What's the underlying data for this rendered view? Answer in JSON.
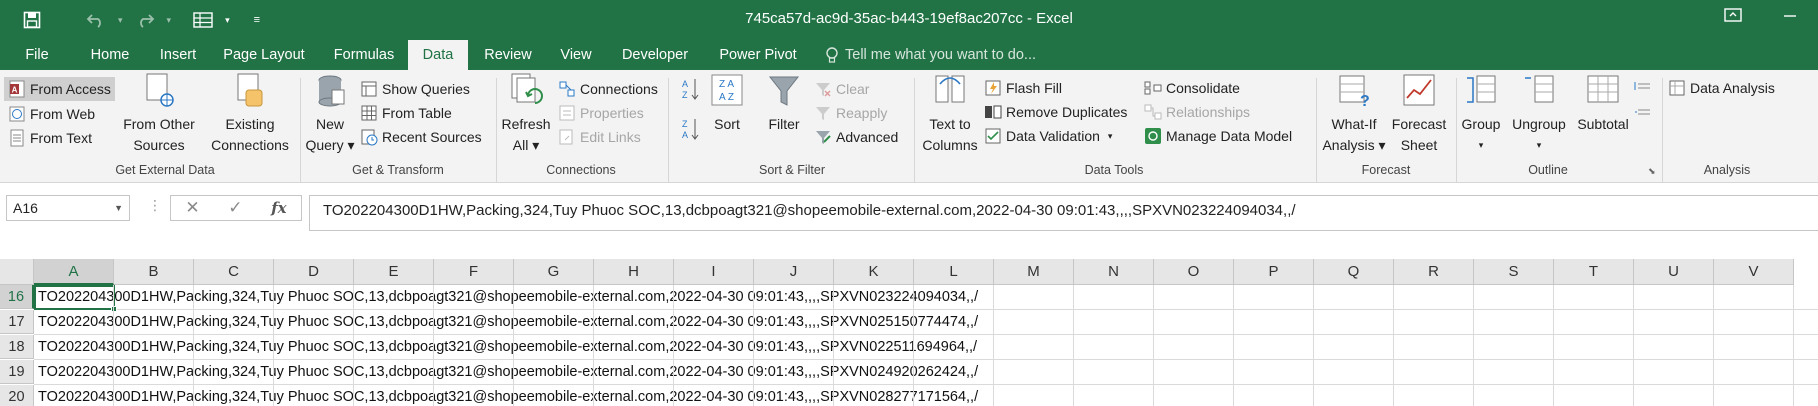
{
  "window": {
    "title": "745ca57d-ac9d-35ac-b443-19ef8ac207cc - Excel",
    "icons": [
      "save-icon",
      "undo-icon",
      "redo-icon",
      "form-icon",
      "customize-qat-icon",
      "ribbon-display-icon",
      "minimize-icon"
    ]
  },
  "tabs": [
    "File",
    "Home",
    "Insert",
    "Page Layout",
    "Formulas",
    "Data",
    "Review",
    "View",
    "Developer",
    "Power Pivot"
  ],
  "active_tab": "Data",
  "tell_me": "Tell me what you want to do...",
  "ribbon": {
    "get_external_data": {
      "label": "Get External Data",
      "from_access": "From Access",
      "from_web": "From Web",
      "from_text": "From Text",
      "from_other_1": "From Other",
      "from_other_2": "Sources",
      "existing_1": "Existing",
      "existing_2": "Connections"
    },
    "get_transform": {
      "label": "Get & Transform",
      "new_query_1": "New",
      "new_query_2": "Query",
      "show_queries": "Show Queries",
      "from_table": "From Table",
      "recent_sources": "Recent Sources"
    },
    "connections": {
      "label": "Connections",
      "refresh_1": "Refresh",
      "refresh_2": "All",
      "connections": "Connections",
      "properties": "Properties",
      "edit_links": "Edit Links"
    },
    "sort_filter": {
      "label": "Sort & Filter",
      "sort": "Sort",
      "filter": "Filter",
      "clear": "Clear",
      "reapply": "Reapply",
      "advanced": "Advanced"
    },
    "data_tools": {
      "label": "Data Tools",
      "text_to_columns_1": "Text to",
      "text_to_columns_2": "Columns",
      "flash_fill": "Flash Fill",
      "remove_duplicates": "Remove Duplicates",
      "data_validation": "Data Validation",
      "consolidate": "Consolidate",
      "relationships": "Relationships",
      "manage_data_model": "Manage Data Model"
    },
    "forecast": {
      "label": "Forecast",
      "what_if_1": "What-If",
      "what_if_2": "Analysis",
      "forecast_sheet_1": "Forecast",
      "forecast_sheet_2": "Sheet"
    },
    "outline": {
      "label": "Outline",
      "group": "Group",
      "ungroup": "Ungroup",
      "subtotal": "Subtotal"
    },
    "analysis": {
      "label": "Analysis",
      "data_analysis": "Data Analysis"
    }
  },
  "formula_bar": {
    "name_box": "A16",
    "formula": "TO202204300D1HW,Packing,324,Tuy Phuoc SOC,13,dcbpoagt321@shopeemobile-external.com,2022-04-30 09:01:43,,,,SPXVN023224094034,,/"
  },
  "sheet": {
    "columns": [
      "A",
      "B",
      "C",
      "D",
      "E",
      "F",
      "G",
      "H",
      "I",
      "J",
      "K",
      "L",
      "M",
      "N",
      "O",
      "P",
      "Q",
      "R",
      "S",
      "T",
      "U",
      "V"
    ],
    "selected_column": "A",
    "selected_row": "16",
    "rows": [
      {
        "num": "16",
        "text": "TO202204300D1HW,Packing,324,Tuy Phuoc SOC,13,dcbpoagt321@shopeemobile-external.com,2022-04-30 09:01:43,,,,SPXVN023224094034,,/"
      },
      {
        "num": "17",
        "text": "TO202204300D1HW,Packing,324,Tuy Phuoc SOC,13,dcbpoagt321@shopeemobile-external.com,2022-04-30 09:01:43,,,,SPXVN025150774474,,/"
      },
      {
        "num": "18",
        "text": "TO202204300D1HW,Packing,324,Tuy Phuoc SOC,13,dcbpoagt321@shopeemobile-external.com,2022-04-30 09:01:43,,,,SPXVN022511694964,,/"
      },
      {
        "num": "19",
        "text": "TO202204300D1HW,Packing,324,Tuy Phuoc SOC,13,dcbpoagt321@shopeemobile-external.com,2022-04-30 09:01:43,,,,SPXVN024920262424,,/"
      },
      {
        "num": "20",
        "text": "TO202204300D1HW,Packing,324,Tuy Phuoc SOC,13,dcbpoagt321@shopeemobile-external.com,2022-04-30 09:01:43,,,,SPXVN028277171564,,/"
      }
    ]
  },
  "colors": {
    "brand": "#217346",
    "ribbon_bg": "#f3f3f3",
    "header_bg": "#e6e6e6"
  }
}
